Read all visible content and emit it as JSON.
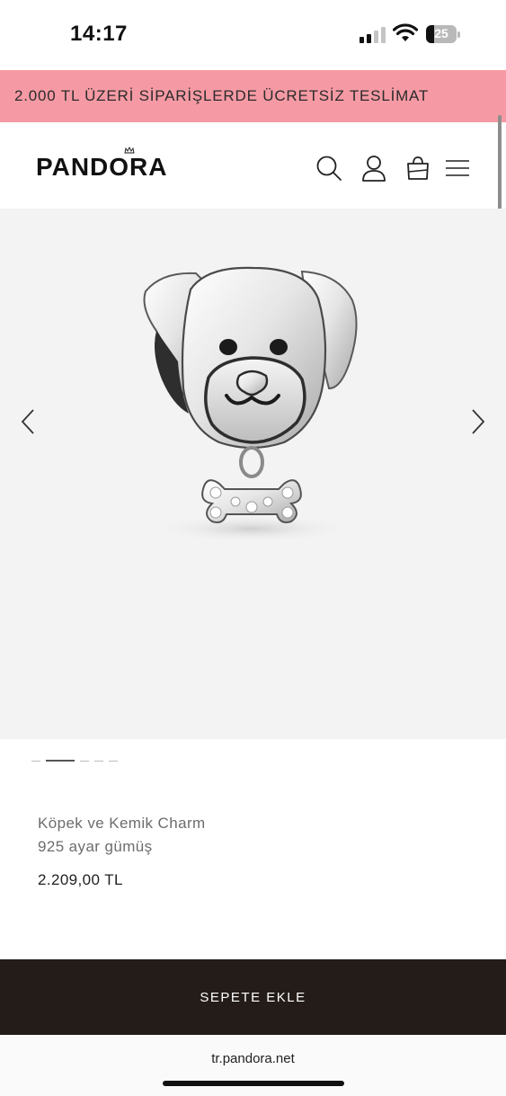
{
  "status_bar": {
    "time": "14:17",
    "battery_level": "25",
    "battery_fraction": 0.25,
    "signal_bars_active": 2,
    "signal_bars_total": 4
  },
  "promo": {
    "text": "2.000 TL ÜZERİ SİPARİŞLERDE ÜCRETSİZ TESLİMAT",
    "background": "#f59aa4"
  },
  "header": {
    "logo": "PANDORA",
    "icons": [
      "search-icon",
      "account-icon",
      "bag-icon",
      "menu-icon"
    ]
  },
  "gallery": {
    "total_images": 5,
    "current_index": 2,
    "background": "#f3f3f3"
  },
  "product": {
    "name": "Köpek ve Kemik Charm",
    "material": "925 ayar gümüş",
    "price": "2.209,00 TL"
  },
  "cta": {
    "label": "SEPETE EKLE",
    "background": "#241c19"
  },
  "browser": {
    "url": "tr.pandora.net"
  }
}
